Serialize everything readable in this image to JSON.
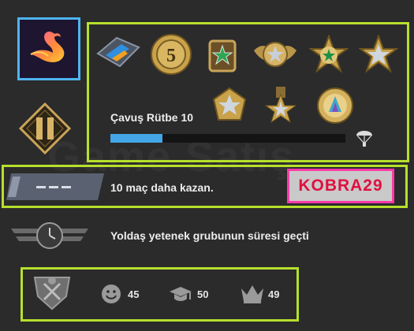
{
  "profile": {
    "rank_name": "Çavuş Rütbe 10",
    "xp_progress": 0.22,
    "mission_text": "10 maç daha kazan.",
    "username": "KOBRA29",
    "skill_group_text": "Yoldaş yetenek grubunun süresi geçti",
    "watermark_text": "Game Satış"
  },
  "commendations": {
    "friendly": "45",
    "teacher": "50",
    "leader": "49"
  },
  "icons": [
    "swan-avatar-icon",
    "rank-chevron-icon",
    "operation-coin-icon",
    "service-medal-5-icon",
    "star-medal-icon",
    "wings-medal-icon",
    "green-star-medal-icon",
    "silver-star-medal-icon",
    "gold-pin-icon",
    "parachute-icon",
    "winged-clock-icon",
    "shield-badge-icon",
    "smiley-icon",
    "graduation-cap-icon",
    "crown-icon"
  ],
  "colors": {
    "highlight": "#b6e02c",
    "xp_bar": "#43a6e8",
    "username": "#e01040",
    "username_border": "#ff3aa8",
    "avatar_border": "#4fb4f2"
  }
}
